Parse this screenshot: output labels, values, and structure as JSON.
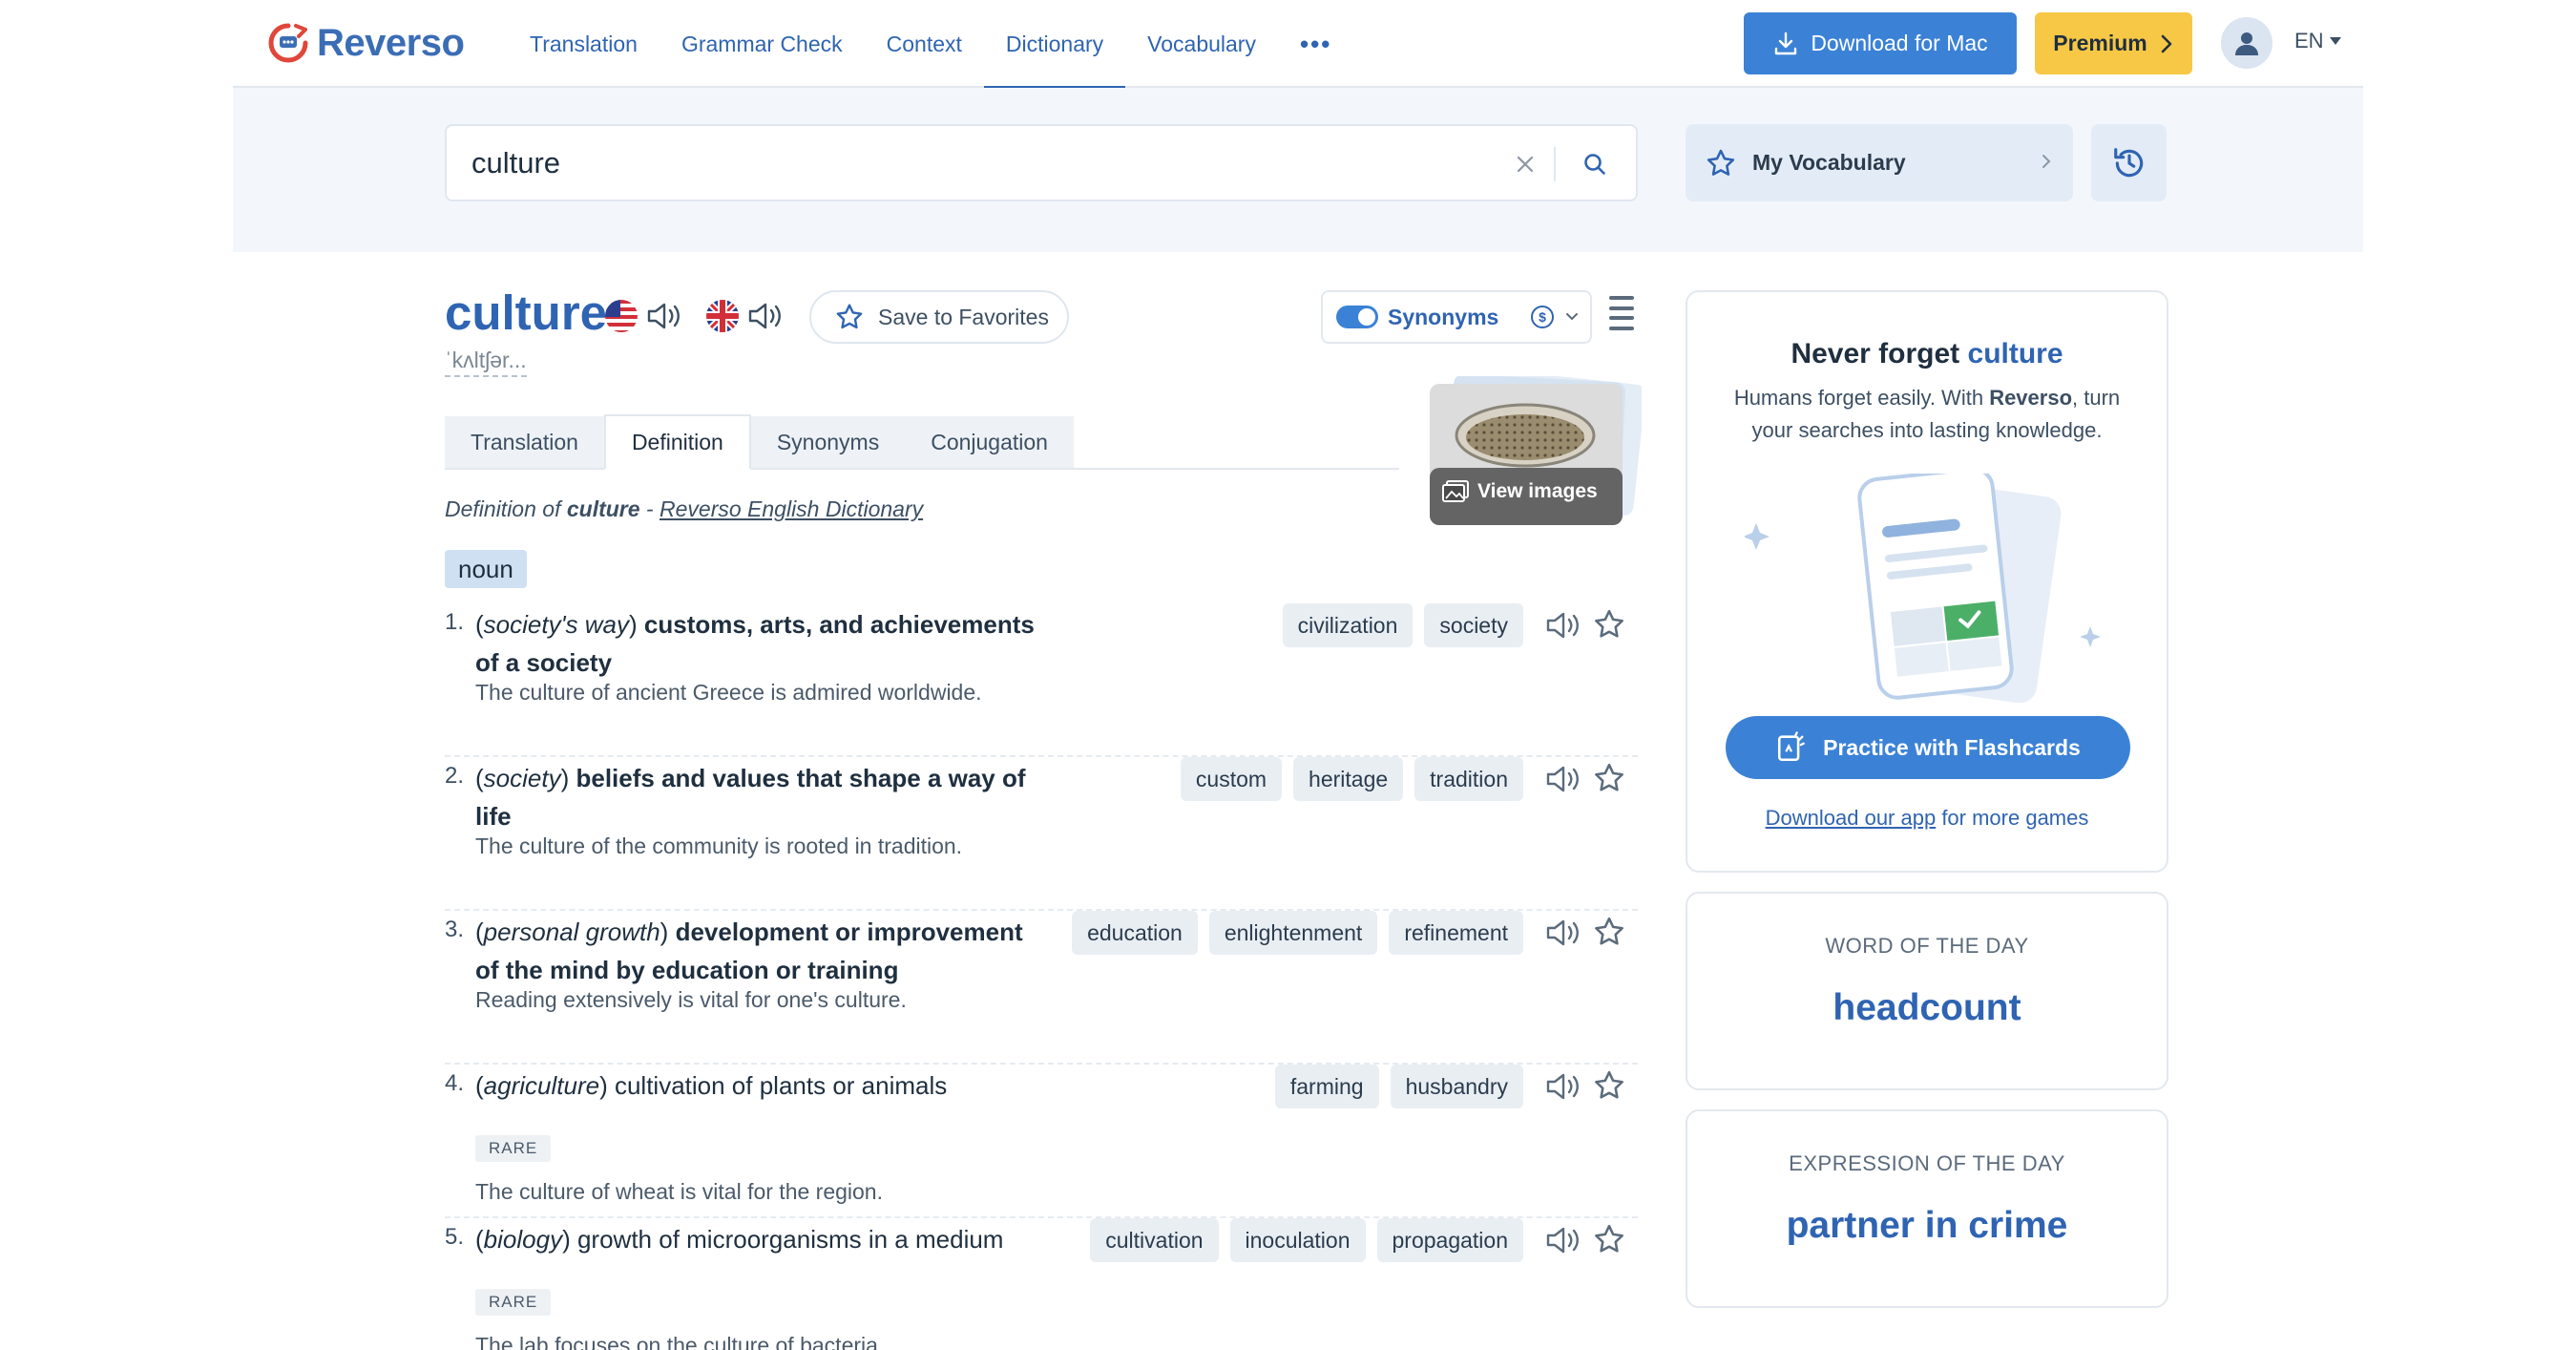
{
  "brand": {
    "name": "Reverso"
  },
  "nav": {
    "links": [
      "Translation",
      "Grammar Check",
      "Context",
      "Dictionary",
      "Vocabulary"
    ],
    "active": "Dictionary",
    "download_label": "Download for Mac",
    "premium_label": "Premium",
    "language": "EN"
  },
  "search": {
    "value": "culture"
  },
  "vocab": {
    "label": "My Vocabulary"
  },
  "entry": {
    "headword": "culture",
    "pronunciation": "ˈkʌltʃər...",
    "save_label": "Save to Favorites",
    "synonyms_toggle_label": "Synonyms",
    "tabs": [
      "Translation",
      "Definition",
      "Synonyms",
      "Conjugation"
    ],
    "active_tab": "Definition",
    "view_images_label": "View images",
    "def_source_prefix": "Definition of",
    "def_source_word": "culture",
    "def_source_sep": " - ",
    "def_source_name": "Reverso English Dictionary",
    "pos": "noun",
    "senses": [
      {
        "num": "1.",
        "domain": "society's way",
        "definition": "customs, arts, and achievements of a society",
        "bold": true,
        "rare": "",
        "example": "The culture of ancient Greece is admired worldwide.",
        "synonyms": [
          "civilization",
          "society"
        ]
      },
      {
        "num": "2.",
        "domain": "society",
        "definition": "beliefs and values that shape a way of life",
        "bold": true,
        "rare": "",
        "example": "The culture of the community is rooted in tradition.",
        "synonyms": [
          "custom",
          "heritage",
          "tradition"
        ]
      },
      {
        "num": "3.",
        "domain": "personal growth",
        "definition": "development or improvement of the mind by education or training",
        "bold": true,
        "rare": "",
        "example": "Reading extensively is vital for one's culture.",
        "synonyms": [
          "education",
          "enlightenment",
          "refinement"
        ]
      },
      {
        "num": "4.",
        "domain": "agriculture",
        "definition": "cultivation of plants or animals",
        "bold": false,
        "rare": "RARE",
        "example": "The culture of wheat is vital for the region.",
        "synonyms": [
          "farming",
          "husbandry"
        ]
      },
      {
        "num": "5.",
        "domain": "biology",
        "definition": "growth of microorganisms in a medium",
        "bold": false,
        "rare": "RARE",
        "example": "The lab focuses on the culture of bacteria.",
        "synonyms": [
          "cultivation",
          "inoculation",
          "propagation"
        ]
      }
    ]
  },
  "promo": {
    "title_prefix": "Never forget",
    "title_word": "culture",
    "body_1": "Humans forget easily. With",
    "body_brand": "Reverso",
    "body_2": ", turn your searches into lasting knowledge.",
    "flashcards_label": "Practice with Flashcards",
    "download_link": "Download our app",
    "download_suffix": " for more games"
  },
  "word_of_day": {
    "label": "WORD OF THE DAY",
    "word": "headcount"
  },
  "expression_of_day": {
    "label": "EXPRESSION OF THE DAY",
    "word": "partner in crime"
  },
  "colors": {
    "brand_blue": "#2f64b2",
    "button_blue": "#3b82d6",
    "premium_yellow": "#f7c845"
  }
}
